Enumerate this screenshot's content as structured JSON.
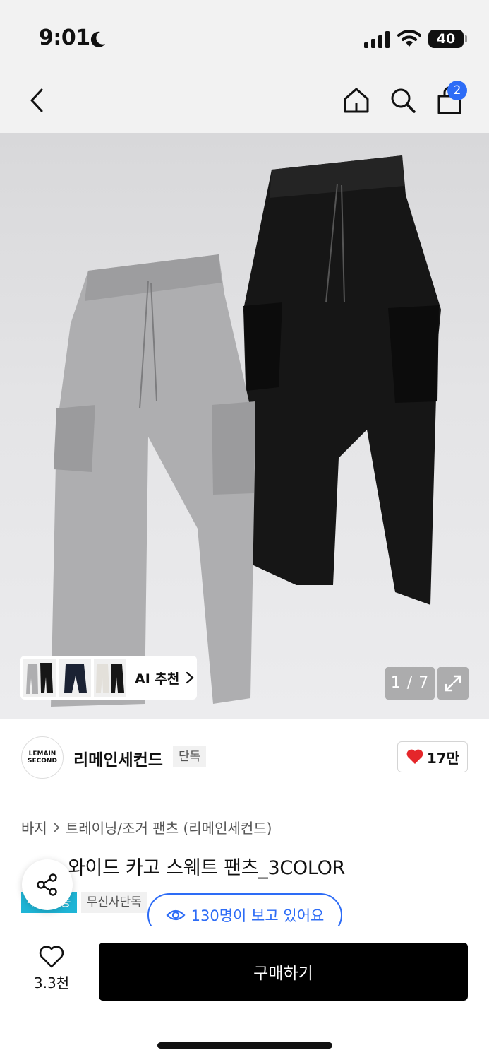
{
  "status_bar": {
    "time": "9:01",
    "battery": "40"
  },
  "nav": {
    "cart_count": "2"
  },
  "gallery": {
    "ai_recommend_label": "AI 추천",
    "counter": "1 / 7"
  },
  "brand": {
    "logo_line1": "LEMAIN",
    "logo_line2": "SECOND",
    "name": "리메인세컨드",
    "tag": "단독",
    "likes": "17만"
  },
  "product": {
    "breadcrumb": [
      "바지",
      "트레이닝/조거 팬츠 (리메인세컨드)"
    ],
    "title": "와이드 카고 스웨트 팬츠_3COLOR",
    "badges": [
      "무료배송",
      "무신사단독"
    ],
    "viewers": "130명이 보고 있어요"
  },
  "bottom": {
    "wish_count": "3.3천",
    "buy_label": "구매하기"
  },
  "colors": {
    "accent": "#2d6cf6",
    "heart": "#e5262a",
    "free_badge": "#1fb5d6"
  }
}
